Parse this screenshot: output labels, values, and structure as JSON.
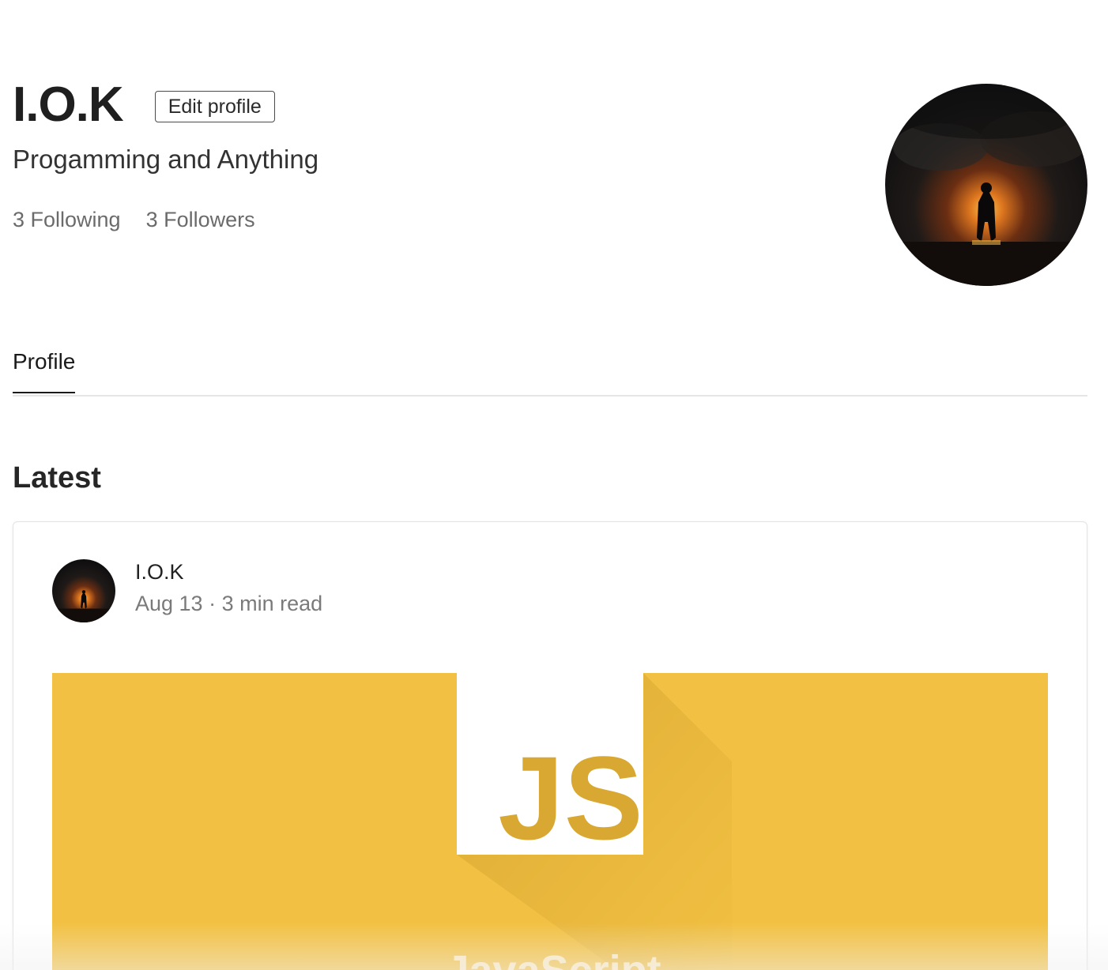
{
  "profile": {
    "name": "I.O.K",
    "edit_label": "Edit profile",
    "bio": "Progamming and Anything",
    "following": "3 Following",
    "followers": "3 Followers"
  },
  "tabs": {
    "profile_label": "Profile"
  },
  "section": {
    "latest_label": "Latest"
  },
  "post": {
    "author": "I.O.K",
    "meta": "Aug 13 · 3 min read",
    "image": {
      "logo_text": "JS",
      "caption": "JavaScript"
    }
  },
  "colors": {
    "js_yellow": "#f2c143",
    "js_shadow": "#d9a832",
    "text_dark": "#1a1a1a",
    "text_muted": "#6b6b6b"
  }
}
